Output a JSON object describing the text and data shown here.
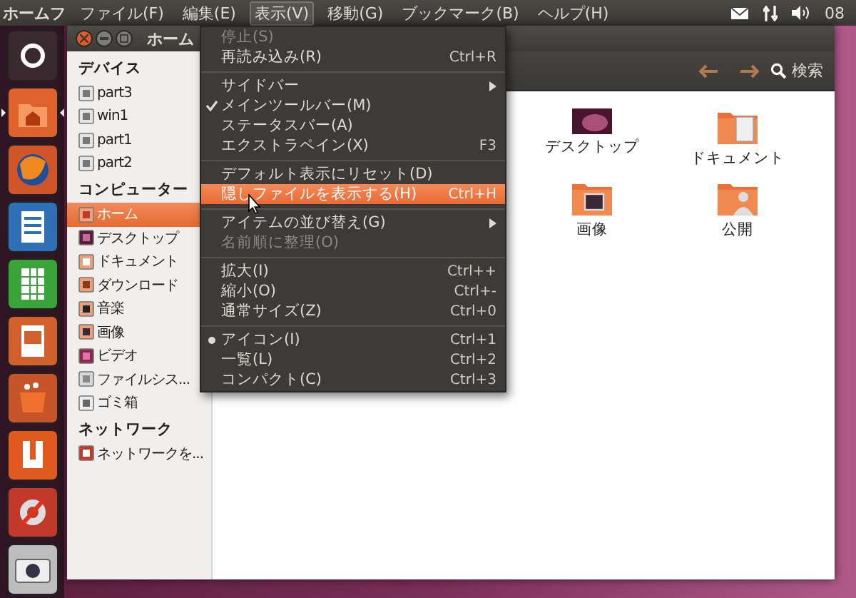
{
  "top_panel": {
    "app_name": "ホームフ",
    "menus": [
      {
        "label": "ファイル(F)",
        "selected": false
      },
      {
        "label": "編集(E)",
        "selected": false
      },
      {
        "label": "表示(V)",
        "selected": true
      },
      {
        "label": "移動(G)",
        "selected": false
      },
      {
        "label": "ブックマーク(B)",
        "selected": false
      },
      {
        "label": "ヘルプ(H)",
        "selected": false
      }
    ],
    "clock": "08"
  },
  "launcher": [
    {
      "kind": "ubuntu",
      "active": false
    },
    {
      "kind": "home",
      "active": true
    },
    {
      "kind": "firefox",
      "active": false
    },
    {
      "kind": "writer",
      "active": false
    },
    {
      "kind": "calc",
      "active": false
    },
    {
      "kind": "impress",
      "active": false
    },
    {
      "kind": "software",
      "active": false
    },
    {
      "kind": "ubuntu_one",
      "active": false
    },
    {
      "kind": "settings",
      "active": false
    },
    {
      "kind": "camera",
      "active": false
    }
  ],
  "window": {
    "title": "ホーム",
    "search_label": "検索"
  },
  "sidebar": [
    {
      "heading": "デバイス",
      "items": [
        {
          "label": "part3",
          "kind": "drive",
          "selected": false
        },
        {
          "label": "win1",
          "kind": "drive",
          "selected": false
        },
        {
          "label": "part1",
          "kind": "drive",
          "selected": false
        },
        {
          "label": "part2",
          "kind": "drive",
          "selected": false
        }
      ]
    },
    {
      "heading": "コンピューター",
      "items": [
        {
          "label": "ホーム",
          "kind": "home",
          "selected": true
        },
        {
          "label": "デスクトップ",
          "kind": "desktop",
          "selected": false
        },
        {
          "label": "ドキュメント",
          "kind": "documents",
          "selected": false
        },
        {
          "label": "ダウンロード",
          "kind": "downloads",
          "selected": false
        },
        {
          "label": "音楽",
          "kind": "music",
          "selected": false
        },
        {
          "label": "画像",
          "kind": "pictures",
          "selected": false
        },
        {
          "label": "ビデオ",
          "kind": "videos",
          "selected": false
        },
        {
          "label": "ファイルシス...",
          "kind": "filesystem",
          "selected": false
        },
        {
          "label": "ゴミ箱",
          "kind": "trash",
          "selected": false
        }
      ]
    },
    {
      "heading": "ネットワーク",
      "items": [
        {
          "label": "ネットワークを...",
          "kind": "network",
          "selected": false
        }
      ]
    }
  ],
  "content": [
    {
      "label": "デスクトップ",
      "kind": "desktop"
    },
    {
      "label": "ドキュメント",
      "kind": "documents"
    },
    {
      "label": "画像",
      "kind": "pictures"
    },
    {
      "label": "公開",
      "kind": "public"
    }
  ],
  "menu": [
    {
      "kind": "item",
      "label": "停止(S)",
      "disabled": true,
      "selected": false
    },
    {
      "kind": "item",
      "label": "再読み込み(R)",
      "shortcut": "Ctrl+R",
      "disabled": false,
      "selected": false
    },
    {
      "kind": "separator"
    },
    {
      "kind": "submenu",
      "label": "サイドバー",
      "disabled": false,
      "selected": false
    },
    {
      "kind": "check",
      "label": "メインツールバー(M)",
      "checked": true,
      "disabled": false,
      "selected": false
    },
    {
      "kind": "check",
      "label": "ステータスバー(A)",
      "checked": false,
      "disabled": false,
      "selected": false
    },
    {
      "kind": "check",
      "label": "エクストラペイン(X)",
      "shortcut": "F3",
      "checked": false,
      "disabled": false,
      "selected": false
    },
    {
      "kind": "separator"
    },
    {
      "kind": "item",
      "label": "デフォルト表示にリセット(D)",
      "disabled": false,
      "selected": false
    },
    {
      "kind": "item",
      "label": "隠しファイルを表示する(H)",
      "shortcut": "Ctrl+H",
      "disabled": false,
      "selected": true
    },
    {
      "kind": "separator"
    },
    {
      "kind": "submenu",
      "label": "アイテムの並び替え(G)",
      "disabled": false,
      "selected": false
    },
    {
      "kind": "item",
      "label": "名前順に整理(O)",
      "disabled": true,
      "selected": false
    },
    {
      "kind": "separator"
    },
    {
      "kind": "item",
      "label": "拡大(I)",
      "shortcut": "Ctrl++",
      "disabled": false,
      "selected": false
    },
    {
      "kind": "item",
      "label": "縮小(O)",
      "shortcut": "Ctrl+-",
      "disabled": false,
      "selected": false
    },
    {
      "kind": "item",
      "label": "通常サイズ(Z)",
      "shortcut": "Ctrl+0",
      "disabled": false,
      "selected": false
    },
    {
      "kind": "separator"
    },
    {
      "kind": "radio",
      "label": "アイコン(I)",
      "shortcut": "Ctrl+1",
      "checked": true,
      "disabled": false,
      "selected": false
    },
    {
      "kind": "radio",
      "label": "一覧(L)",
      "shortcut": "Ctrl+2",
      "checked": false,
      "disabled": false,
      "selected": false
    },
    {
      "kind": "radio",
      "label": "コンパクト(C)",
      "shortcut": "Ctrl+3",
      "checked": false,
      "disabled": false,
      "selected": false
    }
  ]
}
